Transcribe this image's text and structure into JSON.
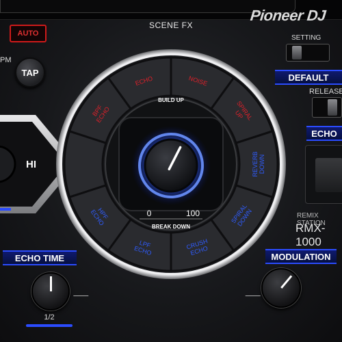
{
  "brand": "Pioneer DJ",
  "left": {
    "auto_label": "AUTO",
    "bpm_fragment": "PM",
    "tap_label": "TAP",
    "hi_label": "HI"
  },
  "scene_fx": {
    "title": "SCENE FX",
    "build_up_label": "BUILD UP",
    "break_down_label": "BREAK DOWN",
    "range_min": "0",
    "range_max": "100",
    "knob_value_fraction": 0.6,
    "top_pads": [
      "BPF\nECHO",
      "ECHO",
      "NOISE",
      "SPIRAL\nUP",
      "REVERB\nUP"
    ],
    "bottom_pads": [
      "HPF\nECHO",
      "LPF\nECHO",
      "CRUSH\nECHO",
      "SPIRAL\nDOWN",
      "REVERB\nDOWN"
    ],
    "colors": {
      "up": "#e0202a",
      "down": "#2f5cff",
      "glow": "#3a6dff"
    }
  },
  "right": {
    "setting_label": "SETTING",
    "default_label": "DEFAULT",
    "release_label": "RELEASE",
    "echo_label": "ECHO",
    "remix_label": "REMIX STATION",
    "model_label": "RMX-1000"
  },
  "bottom": {
    "echo_time_label": "ECHO TIME",
    "echo_time_value": "1/2",
    "modulation_label": "MODULATION"
  }
}
